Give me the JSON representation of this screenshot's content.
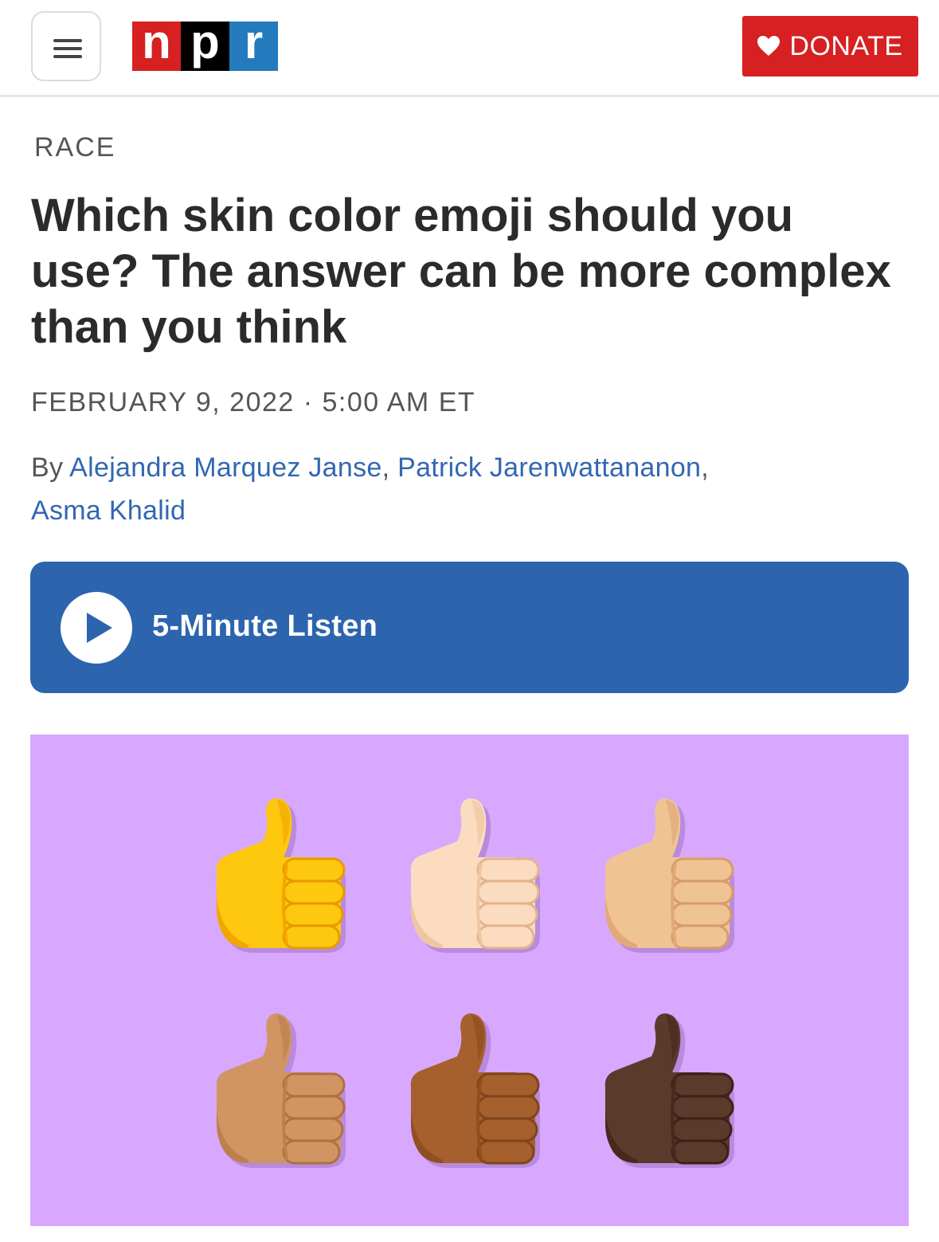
{
  "header": {
    "menu_icon": "hamburger-menu-icon",
    "logo_letters": [
      "n",
      "p",
      "r"
    ],
    "donate_icon": "heart-icon",
    "donate_label": "DONATE"
  },
  "article": {
    "section": "RACE",
    "headline": "Which skin color emoji should you use? The answer can be more complex than you think",
    "dateline": "FEBRUARY 9, 2022 · 5:00 AM ET",
    "byline_prefix": "By ",
    "authors": [
      "Alejandra Marquez Janse",
      "Patrick Jarenwattananon",
      "Asma Khalid"
    ],
    "listen_label": "5-Minute Listen"
  },
  "hero_image": {
    "icon": "thumbs-up-emoji-icon",
    "background": "#d7a8fe",
    "skin_tones": [
      {
        "base": "#fdc80d",
        "shade": "#f2a600",
        "line": "#e89a00"
      },
      {
        "base": "#fbdcc0",
        "shade": "#efc6a2",
        "line": "#e3b38e"
      },
      {
        "base": "#efc394",
        "shade": "#e0a977",
        "line": "#d69c68"
      },
      {
        "base": "#d19563",
        "shade": "#bd7f4d",
        "line": "#b07040"
      },
      {
        "base": "#a6602d",
        "shade": "#8f4f21",
        "line": "#80451b"
      },
      {
        "base": "#5a3a2b",
        "shade": "#47291d",
        "line": "#3b2218"
      }
    ]
  },
  "colors": {
    "npr_red": "#d62021",
    "npr_black": "#000000",
    "npr_blue": "#237bbd",
    "listen_bar": "#2c64ae",
    "link": "#3267b1"
  }
}
